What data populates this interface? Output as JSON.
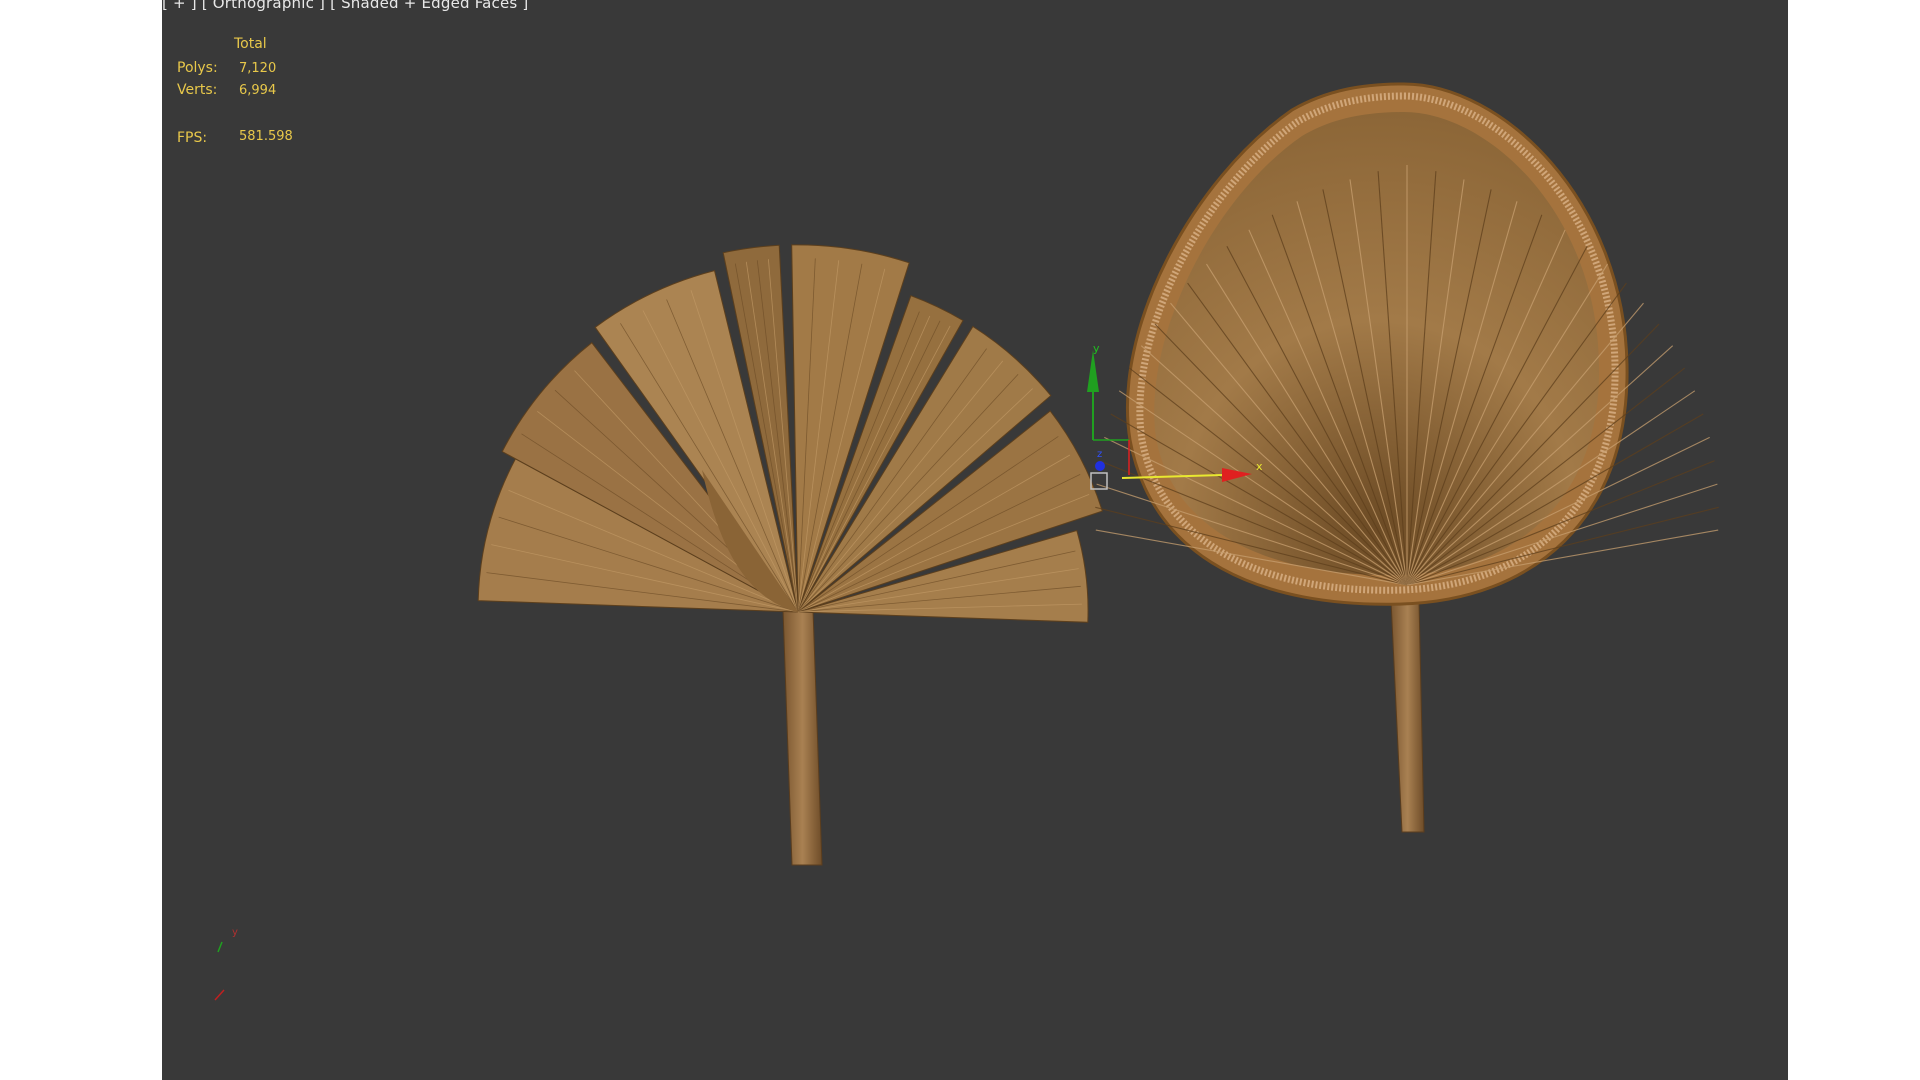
{
  "viewport": {
    "label_plus": "[ + ]",
    "label_view": "[ Orthographic ]",
    "label_shading": "[ Shaded + Edged Faces ]"
  },
  "stats": {
    "header": "Total",
    "polys_label": "Polys:",
    "polys_value": "7,120",
    "verts_label": "Verts:",
    "verts_value": "6,994",
    "fps_label": "FPS:",
    "fps_value": "581.598"
  },
  "gizmo": {
    "x_label": "x",
    "y_label": "y",
    "z_label": "z"
  },
  "colors": {
    "viewport_bg": "#393939",
    "stats_text": "#e8c84a",
    "gizmo_x": "#e02020",
    "gizmo_y": "#20a020",
    "gizmo_z": "#2030e0",
    "leaf_brown": "#9c7440"
  },
  "icons": [
    "move-gizmo-icon",
    "view-axis-tripod-icon"
  ]
}
